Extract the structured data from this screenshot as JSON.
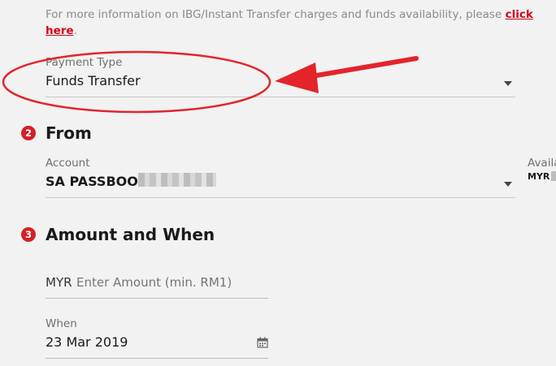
{
  "info": {
    "text_line1": "For more information on IBG/Instant Transfer charges and funds availability, please ",
    "link_part1": "click",
    "link_part2": "here",
    "period": "."
  },
  "payment_type": {
    "label": "Payment Type",
    "value": "Funds Transfer",
    "caret_icon": "chevron-down-icon"
  },
  "annotation": {
    "ellipse_color": "#e3242b",
    "arrow_color": "#e3242b"
  },
  "from_section": {
    "step": "2",
    "title": "From",
    "account_label": "Account",
    "account_value": "SA PASSBOOK",
    "available_label": "Availa",
    "available_currency": "MYR"
  },
  "amount_section": {
    "step": "3",
    "title": "Amount and When",
    "currency": "MYR",
    "amount_placeholder": "Enter Amount (min. RM1)",
    "when_label": "When",
    "when_value": "23 Mar 2019",
    "calendar_icon": "calendar-icon"
  },
  "colors": {
    "accent": "#d42027",
    "background": "#f2f2f2"
  }
}
